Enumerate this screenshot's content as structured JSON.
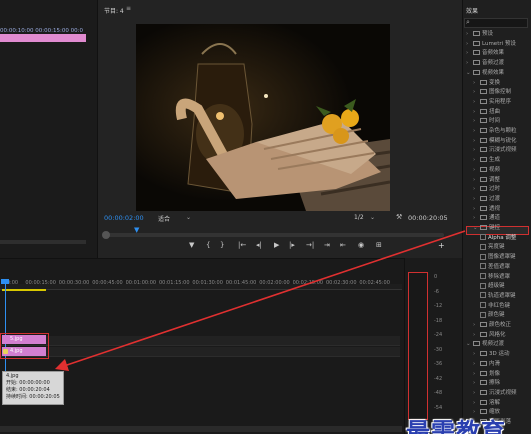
{
  "source_panel": {
    "ruler_text": "00:00:10:00   00:00:15:00   00:0"
  },
  "program_monitor": {
    "tab_label": "节目: 4",
    "menu_glyph": "≡",
    "timecode_current": "00:00:02:00",
    "fit_label": "适合",
    "resolution": "1/2",
    "timecode_duration": "00:00:20:05",
    "transport": [
      "▼",
      "{",
      "}",
      "|←",
      "◂|",
      "▶",
      "|▸",
      "→|",
      "⇥",
      "⇤",
      "◉",
      "⊞"
    ],
    "add_glyph": "+"
  },
  "effects_panel": {
    "title": "效果",
    "search_glyph": "⌕",
    "items": [
      {
        "label": "预设",
        "level": 0,
        "expanded": false
      },
      {
        "label": "Lumetri 预设",
        "level": 0,
        "expanded": false
      },
      {
        "label": "音频效果",
        "level": 0,
        "expanded": false
      },
      {
        "label": "音频过渡",
        "level": 0,
        "expanded": false
      },
      {
        "label": "视频效果",
        "level": 0,
        "expanded": true
      },
      {
        "label": "变换",
        "level": 1,
        "expanded": false
      },
      {
        "label": "图像控制",
        "level": 1,
        "expanded": false
      },
      {
        "label": "实用程序",
        "level": 1,
        "expanded": false
      },
      {
        "label": "扭曲",
        "level": 1,
        "expanded": false
      },
      {
        "label": "时间",
        "level": 1,
        "expanded": false
      },
      {
        "label": "杂色与颗粒",
        "level": 1,
        "expanded": false
      },
      {
        "label": "模糊与锐化",
        "level": 1,
        "expanded": false
      },
      {
        "label": "沉浸式视频",
        "level": 1,
        "expanded": false
      },
      {
        "label": "生成",
        "level": 1,
        "expanded": false
      },
      {
        "label": "视频",
        "level": 1,
        "expanded": false
      },
      {
        "label": "调整",
        "level": 1,
        "expanded": false
      },
      {
        "label": "过时",
        "level": 1,
        "expanded": false
      },
      {
        "label": "过渡",
        "level": 1,
        "expanded": false
      },
      {
        "label": "透视",
        "level": 1,
        "expanded": false
      },
      {
        "label": "通道",
        "level": 1,
        "expanded": false
      },
      {
        "label": "键控",
        "level": 1,
        "expanded": true
      },
      {
        "label": "Alpha 调整",
        "level": 2,
        "highlighted": true
      },
      {
        "label": "亮度键",
        "level": 2
      },
      {
        "label": "图像遮罩键",
        "level": 2
      },
      {
        "label": "差值遮罩",
        "level": 2
      },
      {
        "label": "移除遮罩",
        "level": 2
      },
      {
        "label": "超级键",
        "level": 2
      },
      {
        "label": "轨道遮罩键",
        "level": 2
      },
      {
        "label": "非红色键",
        "level": 2
      },
      {
        "label": "颜色键",
        "level": 2
      },
      {
        "label": "颜色校正",
        "level": 1,
        "expanded": false
      },
      {
        "label": "风格化",
        "level": 1,
        "expanded": false
      },
      {
        "label": "视频过渡",
        "level": 0,
        "expanded": true
      },
      {
        "label": "3D 运动",
        "level": 1,
        "expanded": false
      },
      {
        "label": "内滑",
        "level": 1,
        "expanded": false
      },
      {
        "label": "划像",
        "level": 1,
        "expanded": false
      },
      {
        "label": "擦除",
        "level": 1,
        "expanded": false
      },
      {
        "label": "沉浸式视频",
        "level": 1,
        "expanded": false
      },
      {
        "label": "溶解",
        "level": 1,
        "expanded": false
      },
      {
        "label": "缩放",
        "level": 1,
        "expanded": false
      },
      {
        "label": "页面剥落",
        "level": 1,
        "expanded": false
      }
    ]
  },
  "timeline": {
    "ticks": [
      ":00:00",
      "00:00:15:00",
      "00:00:30:00",
      "00:00:45:00",
      "00:01:00:00",
      "00:01:15:00",
      "00:01:30:00",
      "00:01:45:00",
      "00:02:00:00",
      "00:02:15:00",
      "00:02:30:00",
      "00:02:45:00"
    ],
    "clips": [
      {
        "label": "5.jpg",
        "has_fx": false
      },
      {
        "label": "4.jpg",
        "has_fx": true
      }
    ],
    "tooltip": {
      "name": "4.jpg",
      "start": "开始: 00:00:00:00",
      "end": "结束: 00:00:20:04",
      "duration": "持续时间: 00:00:20:05"
    }
  },
  "audio_meter": {
    "db_labels": [
      "0",
      "-6",
      "-12",
      "-18",
      "-24",
      "-30",
      "-36",
      "-42",
      "-48",
      "-54"
    ]
  },
  "watermark": "最需教育"
}
